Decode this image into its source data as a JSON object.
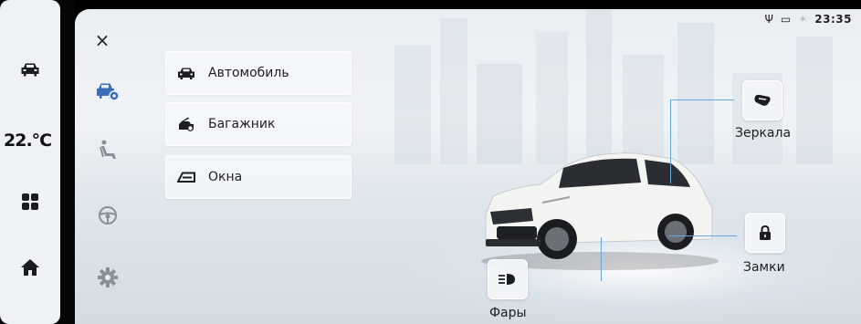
{
  "dock": {
    "temperature": "22.°C",
    "icons": [
      "car-icon",
      "apps-grid-icon",
      "home-icon"
    ]
  },
  "status_bar": {
    "usb_icon": "Ψ",
    "battery_icon": "▭",
    "bluetooth_icon": "✶",
    "time": "23:35"
  },
  "rail": {
    "close": "×",
    "icons": [
      "car-settings-icon",
      "seat-icon",
      "steering-wheel-icon",
      "gear-icon"
    ]
  },
  "menu": {
    "items": [
      {
        "label": "Автомобиль",
        "icon": "car-icon"
      },
      {
        "label": "Багажник",
        "icon": "trunk-icon"
      },
      {
        "label": "Окна",
        "icon": "window-icon"
      }
    ]
  },
  "functions": {
    "mirrors": {
      "label": "Зеркала",
      "icon": "mirror-icon"
    },
    "locks": {
      "label": "Замки",
      "icon": "lock-icon"
    },
    "lights": {
      "label": "Фары",
      "icon": "headlight-icon"
    }
  },
  "colors": {
    "accent": "#3d6fb8",
    "leader_line": "#6aa7e0",
    "car_body": "#f4f4f2"
  }
}
